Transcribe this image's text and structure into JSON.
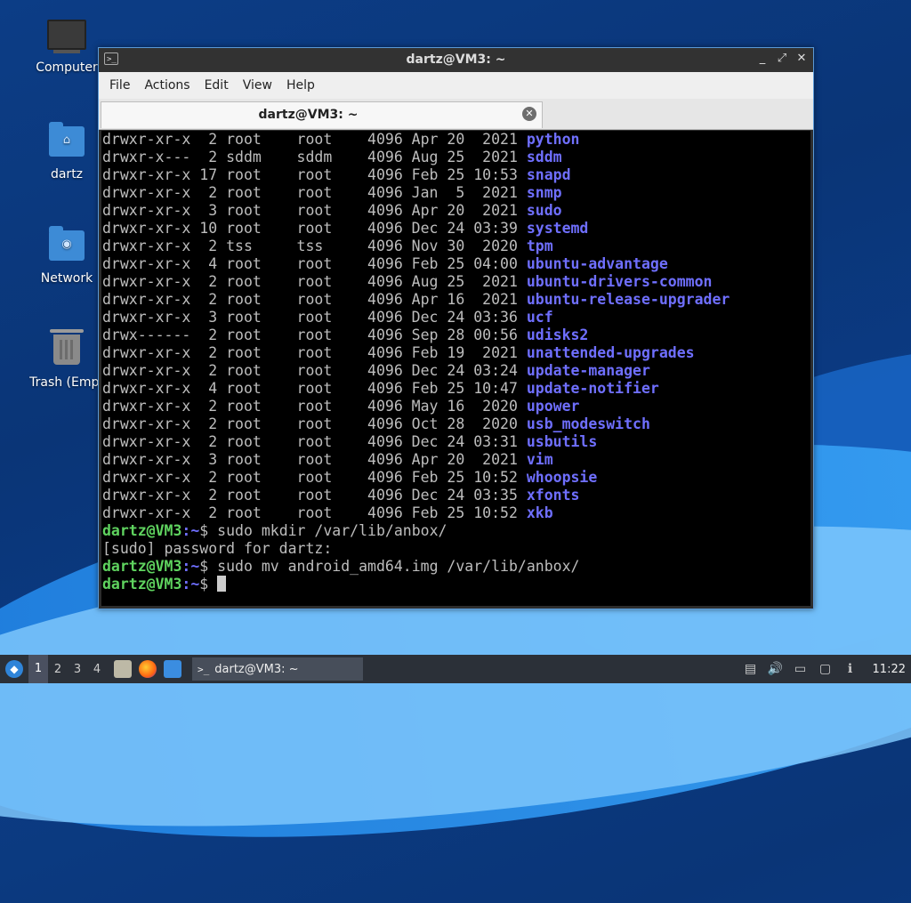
{
  "desktop": {
    "icons": [
      {
        "label": "Computer"
      },
      {
        "label": "dartz"
      },
      {
        "label": "Network"
      },
      {
        "label": "Trash (Empt"
      }
    ]
  },
  "window": {
    "title": "dartz@VM3: ~",
    "controls": {
      "minimize": "_",
      "maximize": "⤢",
      "close": "✕"
    },
    "menu": [
      "File",
      "Actions",
      "Edit",
      "View",
      "Help"
    ],
    "tab": {
      "label": "dartz@VM3: ~",
      "close": "✕"
    }
  },
  "terminal": {
    "listing": [
      {
        "perm": "drwxr-xr-x",
        "links": " 2",
        "owner": "root",
        "group": "root",
        "size": "4096",
        "date": "Apr 20  2021",
        "name": "python"
      },
      {
        "perm": "drwxr-x---",
        "links": " 2",
        "owner": "sddm",
        "group": "sddm",
        "size": "4096",
        "date": "Aug 25  2021",
        "name": "sddm"
      },
      {
        "perm": "drwxr-xr-x",
        "links": "17",
        "owner": "root",
        "group": "root",
        "size": "4096",
        "date": "Feb 25 10:53",
        "name": "snapd"
      },
      {
        "perm": "drwxr-xr-x",
        "links": " 2",
        "owner": "root",
        "group": "root",
        "size": "4096",
        "date": "Jan  5  2021",
        "name": "snmp"
      },
      {
        "perm": "drwxr-xr-x",
        "links": " 3",
        "owner": "root",
        "group": "root",
        "size": "4096",
        "date": "Apr 20  2021",
        "name": "sudo"
      },
      {
        "perm": "drwxr-xr-x",
        "links": "10",
        "owner": "root",
        "group": "root",
        "size": "4096",
        "date": "Dec 24 03:39",
        "name": "systemd"
      },
      {
        "perm": "drwxr-xr-x",
        "links": " 2",
        "owner": "tss",
        "group": "tss",
        "size": "4096",
        "date": "Nov 30  2020",
        "name": "tpm"
      },
      {
        "perm": "drwxr-xr-x",
        "links": " 4",
        "owner": "root",
        "group": "root",
        "size": "4096",
        "date": "Feb 25 04:00",
        "name": "ubuntu-advantage"
      },
      {
        "perm": "drwxr-xr-x",
        "links": " 2",
        "owner": "root",
        "group": "root",
        "size": "4096",
        "date": "Aug 25  2021",
        "name": "ubuntu-drivers-common"
      },
      {
        "perm": "drwxr-xr-x",
        "links": " 2",
        "owner": "root",
        "group": "root",
        "size": "4096",
        "date": "Apr 16  2021",
        "name": "ubuntu-release-upgrader"
      },
      {
        "perm": "drwxr-xr-x",
        "links": " 3",
        "owner": "root",
        "group": "root",
        "size": "4096",
        "date": "Dec 24 03:36",
        "name": "ucf"
      },
      {
        "perm": "drwx------",
        "links": " 2",
        "owner": "root",
        "group": "root",
        "size": "4096",
        "date": "Sep 28 00:56",
        "name": "udisks2"
      },
      {
        "perm": "drwxr-xr-x",
        "links": " 2",
        "owner": "root",
        "group": "root",
        "size": "4096",
        "date": "Feb 19  2021",
        "name": "unattended-upgrades"
      },
      {
        "perm": "drwxr-xr-x",
        "links": " 2",
        "owner": "root",
        "group": "root",
        "size": "4096",
        "date": "Dec 24 03:24",
        "name": "update-manager"
      },
      {
        "perm": "drwxr-xr-x",
        "links": " 4",
        "owner": "root",
        "group": "root",
        "size": "4096",
        "date": "Feb 25 10:47",
        "name": "update-notifier"
      },
      {
        "perm": "drwxr-xr-x",
        "links": " 2",
        "owner": "root",
        "group": "root",
        "size": "4096",
        "date": "May 16  2020",
        "name": "upower"
      },
      {
        "perm": "drwxr-xr-x",
        "links": " 2",
        "owner": "root",
        "group": "root",
        "size": "4096",
        "date": "Oct 28  2020",
        "name": "usb_modeswitch"
      },
      {
        "perm": "drwxr-xr-x",
        "links": " 2",
        "owner": "root",
        "group": "root",
        "size": "4096",
        "date": "Dec 24 03:31",
        "name": "usbutils"
      },
      {
        "perm": "drwxr-xr-x",
        "links": " 3",
        "owner": "root",
        "group": "root",
        "size": "4096",
        "date": "Apr 20  2021",
        "name": "vim"
      },
      {
        "perm": "drwxr-xr-x",
        "links": " 2",
        "owner": "root",
        "group": "root",
        "size": "4096",
        "date": "Feb 25 10:52",
        "name": "whoopsie"
      },
      {
        "perm": "drwxr-xr-x",
        "links": " 2",
        "owner": "root",
        "group": "root",
        "size": "4096",
        "date": "Dec 24 03:35",
        "name": "xfonts"
      },
      {
        "perm": "drwxr-xr-x",
        "links": " 2",
        "owner": "root",
        "group": "root",
        "size": "4096",
        "date": "Feb 25 10:52",
        "name": "xkb"
      }
    ],
    "session": [
      {
        "type": "prompt",
        "user": "dartz@VM3",
        "path": ":~",
        "symbol": "$ ",
        "cmd": "sudo mkdir /var/lib/anbox/"
      },
      {
        "type": "output",
        "text": "[sudo] password for dartz:"
      },
      {
        "type": "prompt",
        "user": "dartz@VM3",
        "path": ":~",
        "symbol": "$ ",
        "cmd": "sudo mv android_amd64.img /var/lib/anbox/"
      },
      {
        "type": "prompt",
        "user": "dartz@VM3",
        "path": ":~",
        "symbol": "$ ",
        "cmd": "",
        "cursor": true
      }
    ]
  },
  "taskbar": {
    "workspaces": [
      "1",
      "2",
      "3",
      "4"
    ],
    "active_workspace": "1",
    "task_label": "dartz@VM3: ~",
    "clock": "11:22"
  }
}
